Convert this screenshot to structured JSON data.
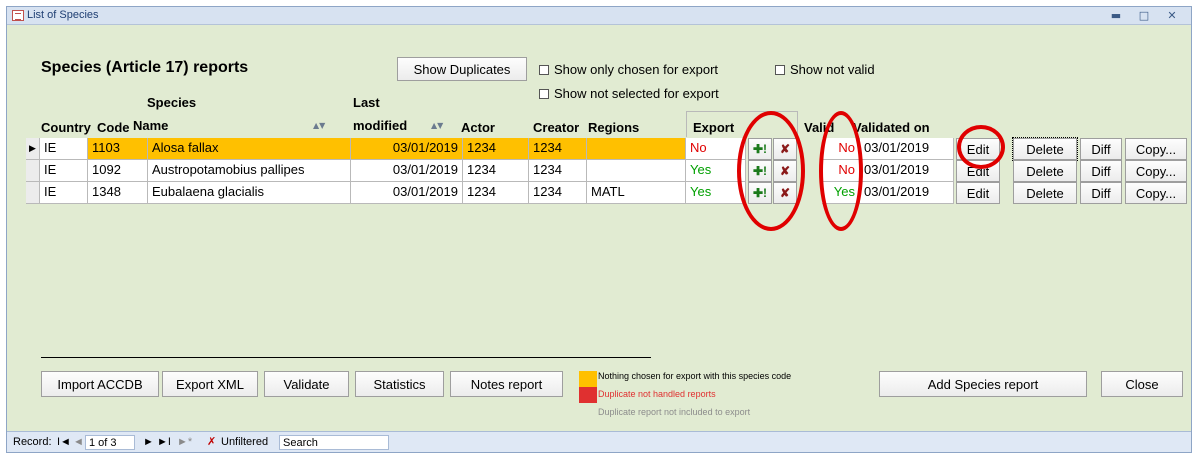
{
  "window": {
    "title": "List of Species",
    "minimize_icon": "minimize-icon",
    "restore_icon": "restore-icon",
    "close_icon": "close-icon"
  },
  "heading": "Species (Article 17) reports",
  "filters": {
    "show_duplicates": "Show Duplicates",
    "only_chosen": "Show only chosen for export",
    "not_valid": "Show not valid",
    "not_selected": "Show not selected for export"
  },
  "columns": {
    "country": "Country",
    "code": "Code",
    "species_name_1": "Species",
    "species_name_2": "Name",
    "last_modified_1": "Last",
    "last_modified_2": "modified",
    "actor": "Actor",
    "creator": "Creator",
    "regions": "Regions",
    "export": "Export",
    "valid": "Valid",
    "validated_on": "Validated on"
  },
  "rows": [
    {
      "country": "IE",
      "code": "1103",
      "species": "Alosa fallax",
      "modified": "03/01/2019",
      "actor": "1234",
      "creator": "1234",
      "regions": "",
      "export": "No",
      "valid": "No",
      "validated_on": "03/01/2019"
    },
    {
      "country": "IE",
      "code": "1092",
      "species": "Austropotamobius pallipes",
      "modified": "03/01/2019",
      "actor": "1234",
      "creator": "1234",
      "regions": "",
      "export": "Yes",
      "valid": "No",
      "validated_on": "03/01/2019"
    },
    {
      "country": "IE",
      "code": "1348",
      "species": "Eubalaena glacialis",
      "modified": "03/01/2019",
      "actor": "1234",
      "creator": "1234",
      "regions": "MATL",
      "export": "Yes",
      "valid": "Yes",
      "validated_on": "03/01/2019"
    }
  ],
  "row_buttons": {
    "edit": "Edit",
    "delete": "Delete",
    "diff": "Diff",
    "copy": "Copy..."
  },
  "row_icons": {
    "add_export": "add-to-export-icon",
    "remove_export": "remove-from-export-icon"
  },
  "footer_buttons": {
    "import": "Import ACCDB",
    "export_xml": "Export XML",
    "validate": "Validate",
    "statistics": "Statistics",
    "notes": "Notes report",
    "add": "Add Species report",
    "close": "Close"
  },
  "legend": {
    "nothing_chosen": "Nothing chosen for export with this species code",
    "dup_not_handled": "Duplicate not handled reports",
    "dup_not_included": "Duplicate report not included to export"
  },
  "status": {
    "record_label": "Record:",
    "first": "I◄",
    "prev": "◄",
    "position": "1 of 3",
    "next": "►",
    "last": "►I",
    "new": "►*",
    "filter": "Unfiltered",
    "search": "Search"
  },
  "colors": {
    "form_bg": "#e1ebd2",
    "highlight": "#ffc000",
    "no_red": "#e00000",
    "yes_green": "#00a000",
    "legend_red": "#e03030",
    "annotation_red": "#e00000"
  }
}
